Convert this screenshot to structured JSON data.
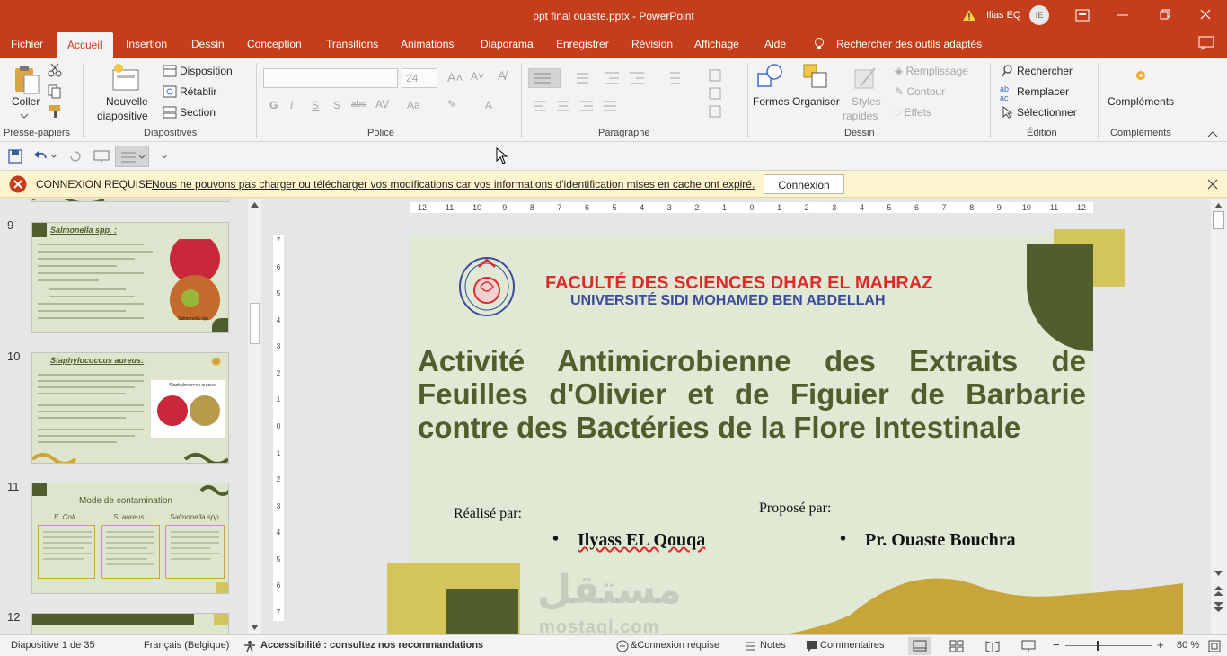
{
  "window": {
    "title": "ppt final ouaste.pptx  -  PowerPoint",
    "user": "Ilias EQ",
    "avatar": "IE"
  },
  "menu": [
    "Fichier",
    "Accueil",
    "Insertion",
    "Dessin",
    "Conception",
    "Transitions",
    "Animations",
    "Diaporama",
    "Enregistrer",
    "Révision",
    "Affichage",
    "Aide"
  ],
  "search_label": "Rechercher des outils adaptés",
  "ribbon": {
    "clipboard": {
      "paste": "Coller",
      "group": "Presse-papiers"
    },
    "slides": {
      "new_slide_1": "Nouvelle",
      "new_slide_2": "diapositive",
      "layout": "Disposition",
      "reset": "Rétablir",
      "section": "Section",
      "group": "Diapositives"
    },
    "font": {
      "size": "24",
      "group": "Police"
    },
    "paragraph": {
      "group": "Paragraphe"
    },
    "drawing": {
      "shapes": "Formes",
      "arrange": "Organiser",
      "styles_1": "Styles",
      "styles_2": "rapides",
      "fill": "Remplissage",
      "outline": "Contour",
      "effects": "Effets",
      "group": "Dessin"
    },
    "editing": {
      "find": "Rechercher",
      "replace": "Remplacer",
      "select": "Sélectionner",
      "group": "Édition"
    },
    "addins": {
      "label": "Compléments",
      "group": "Compléments"
    }
  },
  "infobar": {
    "title": "CONNEXION REQUISE",
    "message": "Nous ne pouvons pas charger ou télécharger vos modifications car vos informations d'identification mises en cache ont expiré.",
    "button": "Connexion"
  },
  "thumbnails": [
    {
      "num": "9",
      "title": "Salmonella spp. :",
      "caption": "Salmonella spp"
    },
    {
      "num": "10",
      "title": "Staphylococcus aureus:",
      "inset": "Staphylococcus aureus"
    },
    {
      "num": "11",
      "title": "Mode de contamination",
      "cols": [
        "E. Coli",
        "S. aureus",
        "Salmonella spp."
      ]
    },
    {
      "num": "12"
    }
  ],
  "ruler_h": [
    "12",
    "11",
    "10",
    "9",
    "8",
    "7",
    "6",
    "5",
    "4",
    "3",
    "2",
    "1",
    "0",
    "1",
    "2",
    "3",
    "4",
    "5",
    "6",
    "7",
    "8",
    "9",
    "10",
    "11",
    "12"
  ],
  "ruler_v": [
    "7",
    "6",
    "5",
    "4",
    "3",
    "2",
    "1",
    "0",
    "1",
    "2",
    "3",
    "4",
    "5",
    "6",
    "7"
  ],
  "slide": {
    "faculty": "FACULTÉ DES SCIENCES DHAR EL MAHRAZ",
    "university": "UNIVERSITÉ SIDI MOHAMED BEN ABDELLAH",
    "title_lines": [
      "Activité Antimicrobienne des Extraits de",
      "Feuilles d'Olivier et de Figuier de Barbarie",
      "contre des Bactéries de la Flore Intestinale"
    ],
    "made_by_label": "Réalisé par:",
    "made_by": "Ilyass EL Qouqa",
    "proposed_by_label": "Proposé par:",
    "proposed_by": "Pr. Ouaste Bouchra"
  },
  "watermark": {
    "arabic": "مستقل",
    "latin": "mostaql.com"
  },
  "status": {
    "slide": "Diapositive 1 de 35",
    "language": "Français (Belgique)",
    "accessibility": "Accessibilité : consultez nos recommandations",
    "connection": "&Connexion requise",
    "notes": "Notes",
    "comments": "Commentaires",
    "zoom": "80 %"
  },
  "colors": {
    "brand": "#c43e1c",
    "olive": "#4f5e2c",
    "mustard": "#d3c55c",
    "gold": "#c8a53a",
    "title_green": "#4f5e2c",
    "red": "#e02a2a",
    "blue": "#3b4a9a"
  }
}
